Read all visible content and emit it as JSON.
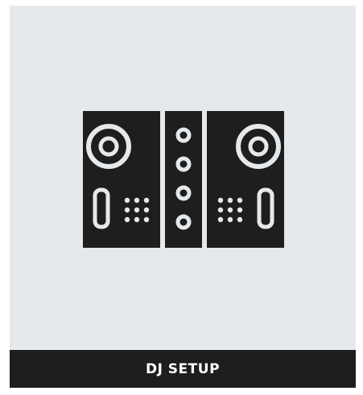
{
  "card": {
    "background": "#e6e9ec",
    "icon": "dj-controller-icon",
    "icon_color": "#1e1e1e",
    "caption": "DJ SETUP",
    "caption_background": "#1e1e1e",
    "caption_color": "#ffffff"
  }
}
